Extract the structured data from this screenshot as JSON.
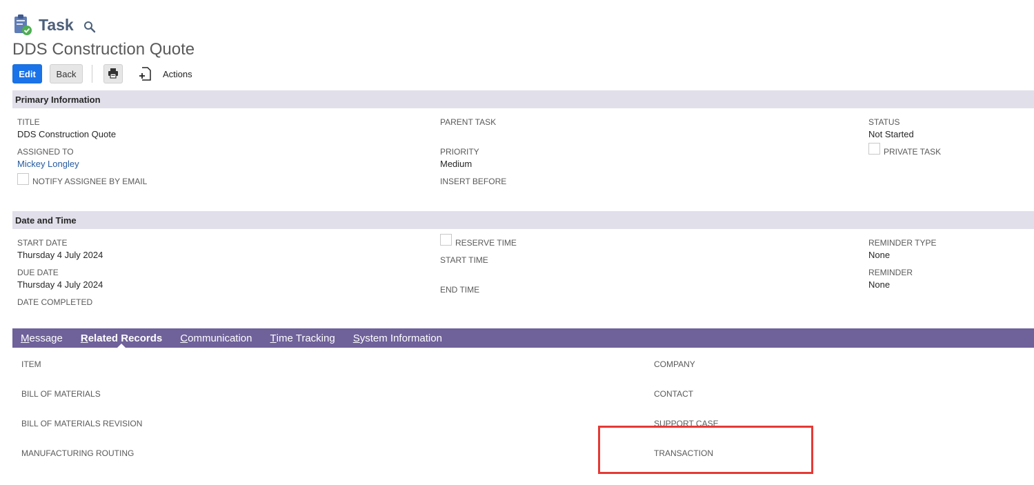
{
  "header": {
    "record_type": "Task",
    "record_title": "DDS Construction Quote"
  },
  "toolbar": {
    "edit": "Edit",
    "back": "Back",
    "actions": "Actions"
  },
  "primary": {
    "section_title": "Primary Information",
    "title_label": "TITLE",
    "title_value": "DDS Construction Quote",
    "assigned_label": "ASSIGNED TO",
    "assigned_value": "Mickey Longley",
    "notify_label": "NOTIFY ASSIGNEE BY EMAIL",
    "parent_label": "PARENT TASK",
    "priority_label": "PRIORITY",
    "priority_value": "Medium",
    "insert_label": "INSERT BEFORE",
    "status_label": "STATUS",
    "status_value": "Not Started",
    "private_label": "PRIVATE TASK"
  },
  "datetime": {
    "section_title": "Date and Time",
    "start_date_label": "START DATE",
    "start_date_value": "Thursday 4 July 2024",
    "due_date_label": "DUE DATE",
    "due_date_value": "Thursday 4 July 2024",
    "completed_label": "DATE COMPLETED",
    "reserve_label": "RESERVE TIME",
    "start_time_label": "START TIME",
    "end_time_label": "END TIME",
    "reminder_type_label": "REMINDER TYPE",
    "reminder_type_value": "None",
    "reminder_label": "REMINDER",
    "reminder_value": "None"
  },
  "tabs": [
    {
      "first": "M",
      "rest": "essage"
    },
    {
      "first": "R",
      "rest": "elated Records"
    },
    {
      "first": "C",
      "rest": "ommunication"
    },
    {
      "first": "T",
      "rest": "ime Tracking"
    },
    {
      "first": "S",
      "rest": "ystem Information"
    }
  ],
  "related": {
    "left": [
      "ITEM",
      "BILL OF MATERIALS",
      "BILL OF MATERIALS REVISION",
      "MANUFACTURING ROUTING"
    ],
    "right": [
      "COMPANY",
      "CONTACT",
      "SUPPORT CASE",
      "TRANSACTION"
    ]
  },
  "colors": {
    "accent": "#1a73e8",
    "tabbar": "#6f619a",
    "section": "#e1dfea",
    "highlight": "#e53935"
  }
}
